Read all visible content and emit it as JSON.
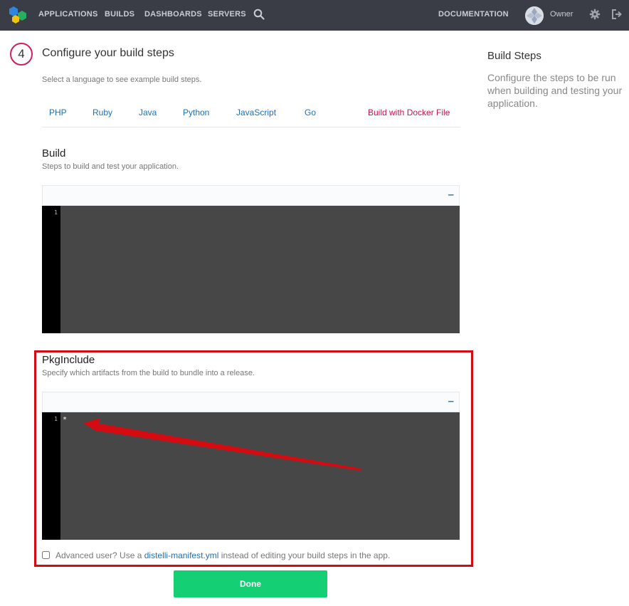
{
  "nav": {
    "links": [
      "APPLICATIONS",
      "BUILDS",
      "DASHBOARDS",
      "SERVERS"
    ],
    "documentation": "DOCUMENTATION",
    "user": "Owner"
  },
  "step": {
    "number": "4",
    "title": "Configure your build steps",
    "hint": "Select a language to see example build steps."
  },
  "languages": [
    "PHP",
    "Ruby",
    "Java",
    "Python",
    "JavaScript",
    "Go"
  ],
  "docker_tab": "Build with Docker File",
  "build": {
    "title": "Build",
    "hint": "Steps to build and test your application.",
    "collapse": "–",
    "line_number": "1",
    "code": ""
  },
  "pkginclude": {
    "title": "PkgInclude",
    "hint": "Specify which artifacts from the build to bundle into a release.",
    "collapse": "–",
    "line_number": "1",
    "code": "*"
  },
  "advanced": {
    "prefix": "Advanced user? Use a ",
    "link": "distelli-manifest.yml",
    "suffix": " instead of editing your build steps in the app.",
    "checked": false
  },
  "done_label": "Done",
  "sidebar": {
    "title": "Build Steps",
    "description": "Configure the steps to be run when building and testing your application."
  },
  "colors": {
    "nav_bg": "#3a3d45",
    "accent_pink": "#d11f5a",
    "link_blue": "#1f6fb5",
    "done_green": "#14cf74",
    "annotation_red": "#d40b10"
  }
}
